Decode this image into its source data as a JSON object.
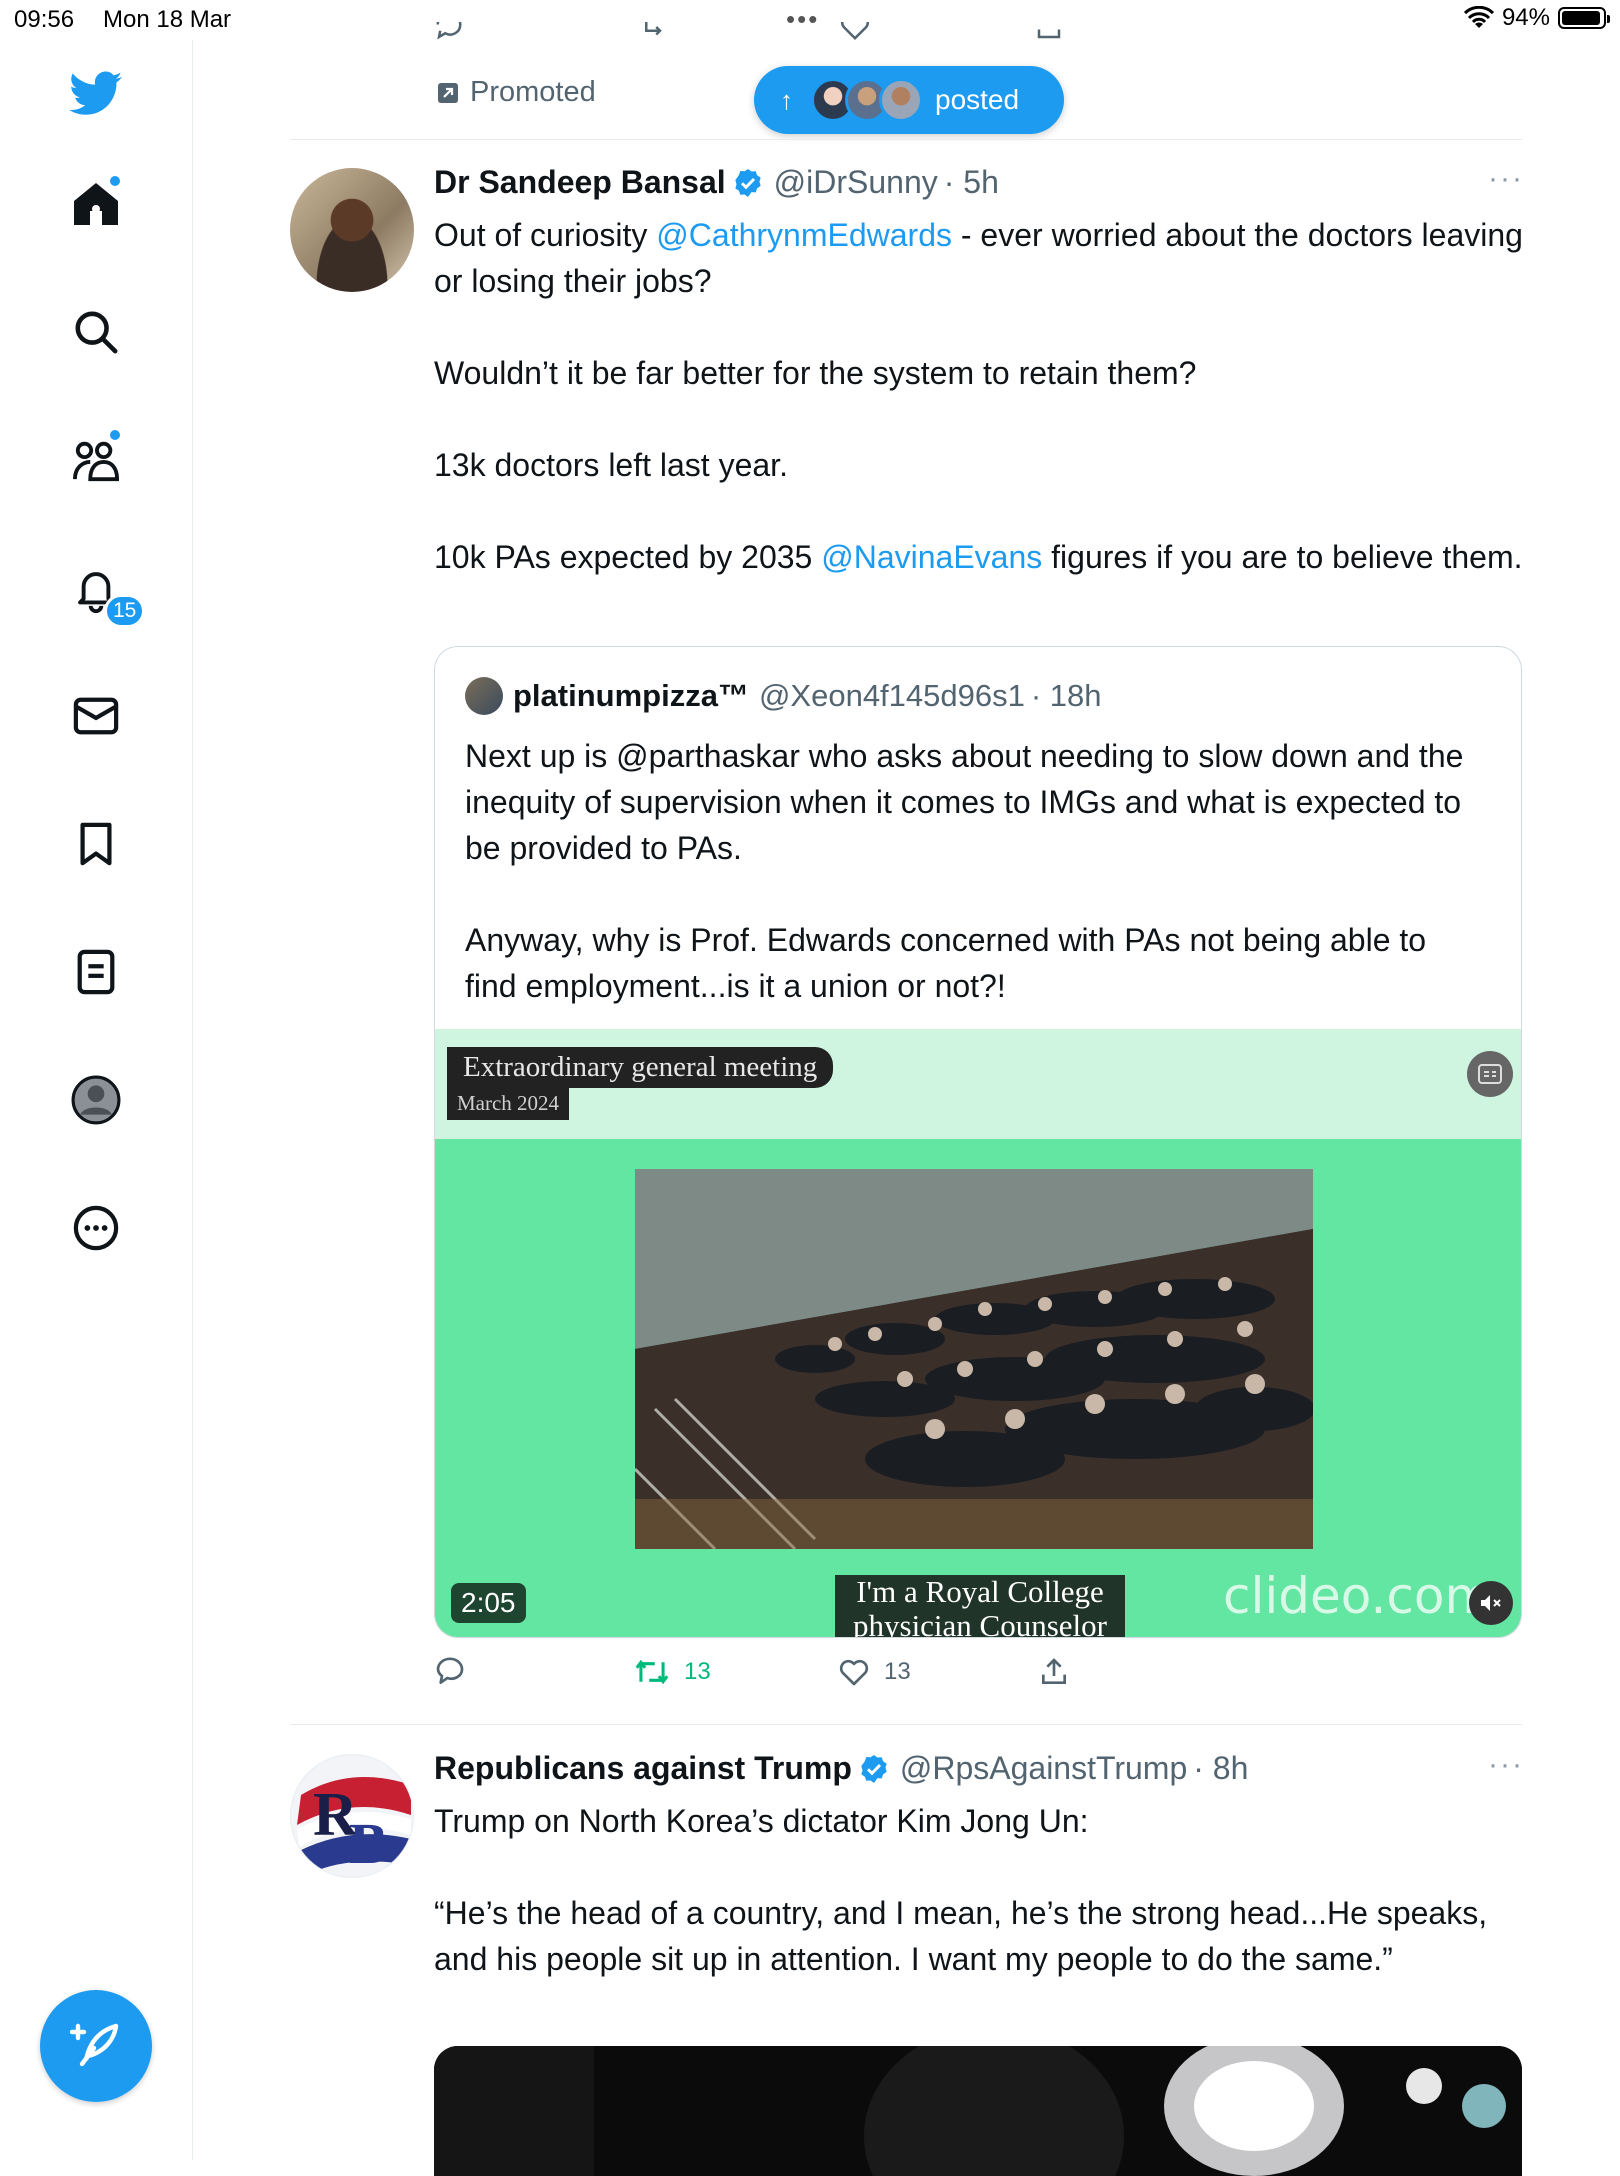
{
  "status_bar": {
    "time": "09:56",
    "date": "Mon 18 Mar",
    "battery_text": "94%",
    "battery_level": 0.94
  },
  "sidebar": {
    "items": [
      {
        "icon": "twitter-logo-icon"
      },
      {
        "icon": "home-icon"
      },
      {
        "icon": "search-icon"
      },
      {
        "icon": "communities-icon"
      },
      {
        "icon": "notifications-bell-icon",
        "badge": "15"
      },
      {
        "icon": "messages-envelope-icon"
      },
      {
        "icon": "bookmarks-icon"
      },
      {
        "icon": "lists-icon"
      },
      {
        "icon": "profile-avatar-icon"
      },
      {
        "icon": "more-options-icon"
      }
    ],
    "compose_icon": "compose-feather-icon"
  },
  "feed": {
    "promoted_label": "Promoted",
    "new_posts_pill": {
      "label": "posted"
    },
    "tweets": [
      {
        "name": "Dr Sandeep Bansal",
        "handle": "@iDrSunny",
        "time": "· 5h",
        "more": "···",
        "text_parts": {
          "p1_before": "Out of curiosity ",
          "p1_mention": "@CathrynmEdwards",
          "p1_after": " - ever worried about the doctors leaving or losing their jobs?",
          "p2": "Wouldn’t it be far better for the system to retain them?",
          "p3": "13k doctors left last year.",
          "p4_before": "10k PAs expected by 2035 ",
          "p4_mention": "@NavinaEvans",
          "p4_after": " figures if you are to believe them."
        },
        "quote": {
          "name": "platinumpizza™",
          "handle": "@Xeon4f145d96s1",
          "time": "· 18h",
          "text": "Next up is @parthaskar who asks about needing to slow down and the inequity of supervision when it comes to IMGs and what is expected to be provided to PAs.\n\nAnyway, why is Prof. Edwards concerned with PAs not being able to find employment...is it a union or not?!",
          "video": {
            "overlay_title": "Extraordinary general meeting",
            "overlay_subtitle": "March 2024",
            "duration": "2:05",
            "caption": "I'm a Royal College physician Counselor",
            "watermark": "clideo.com"
          }
        },
        "actions": {
          "reply_count": "",
          "retweet_count": "13",
          "like_count": "13"
        }
      },
      {
        "name": "Republicans against Trump",
        "handle": "@RpsAgainstTrump",
        "time": "· 8h",
        "more": "···",
        "text": "Trump on North Korea’s dictator Kim Jong Un:\n\n“He’s the head of a country, and I mean, he’s the strong head...He speaks, and his people sit up in attention. I want my people to do the same.”",
        "avatar_letters": "RB"
      }
    ]
  },
  "colors": {
    "accent": "#1d9bf0",
    "retweet_green": "#00ba7c",
    "text": "#0f1419",
    "secondary": "#536471",
    "video_green": "#63e6a2"
  }
}
